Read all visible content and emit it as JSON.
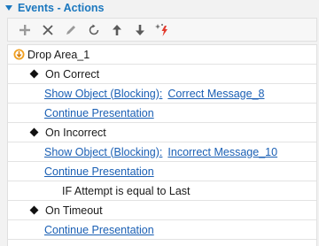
{
  "header": {
    "title": "Events - Actions"
  },
  "toolbar": {
    "buttons": [
      {
        "name": "add-button",
        "icon": "plus-icon"
      },
      {
        "name": "delete-button",
        "icon": "close-icon"
      },
      {
        "name": "edit-button",
        "icon": "pencil-icon"
      },
      {
        "name": "reset-button",
        "icon": "rotate-icon"
      },
      {
        "name": "move-up-button",
        "icon": "arrow-up-icon"
      },
      {
        "name": "move-down-button",
        "icon": "arrow-down-icon"
      },
      {
        "name": "trigger-wizard-button",
        "icon": "sparkle-lightning-icon"
      }
    ]
  },
  "tree": {
    "object": {
      "label": "Drop Area_1",
      "icon": "drop-area-icon"
    },
    "events": [
      {
        "label": "On Correct",
        "actions": [
          {
            "action": "Show Object (Blocking):",
            "target": "Correct Message_8"
          },
          {
            "action": "Continue Presentation"
          }
        ]
      },
      {
        "label": "On Incorrect",
        "actions": [
          {
            "action": "Show Object (Blocking):",
            "target": "Incorrect Message_10"
          },
          {
            "action": "Continue Presentation"
          }
        ],
        "condition": "IF Attempt is equal to Last"
      },
      {
        "label": "On Timeout",
        "actions": [
          {
            "action": "Continue Presentation"
          }
        ]
      }
    ]
  },
  "colors": {
    "accent": "#1b78bf",
    "link": "#1a5fb4",
    "disabled_icon": "#9a9a9a",
    "wizard_spark": "#e23b2e"
  }
}
